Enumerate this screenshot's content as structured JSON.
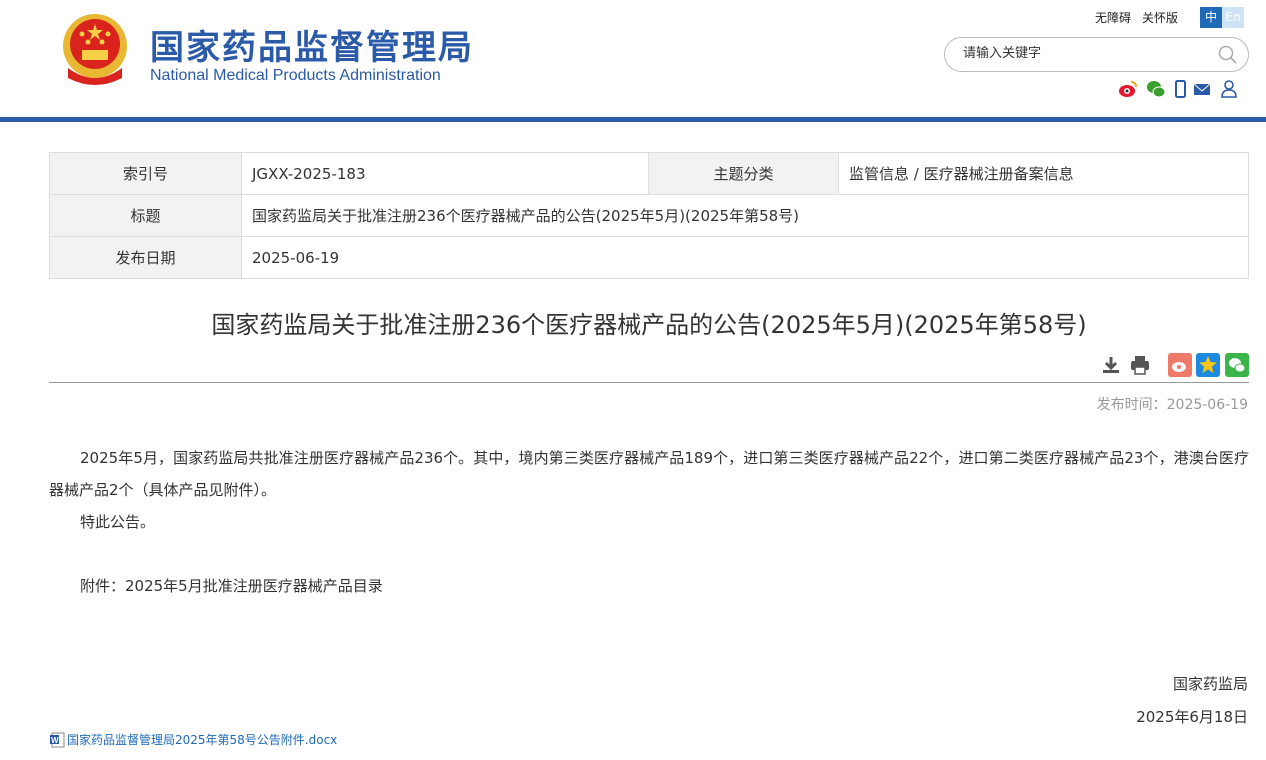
{
  "header": {
    "site_title": "国家药品监督管理局",
    "site_subtitle": "National Medical Products Administration",
    "accessibility": "无障碍",
    "care_mode": "关怀版",
    "lang_zh": "中",
    "lang_en": "En",
    "search_placeholder": "请输入关键字",
    "brand_color": "#2b5aa8"
  },
  "meta": {
    "index_label": "索引号",
    "index_value": "JGXX-2025-183",
    "category_label": "主题分类",
    "category_value": "监管信息 / 医疗器械注册备案信息",
    "title_label": "标题",
    "title_value": "国家药监局关于批准注册236个医疗器械产品的公告(2025年5月)(2025年第58号)",
    "date_label": "发布日期",
    "date_value": "2025-06-19"
  },
  "article": {
    "title": "国家药监局关于批准注册236个医疗器械产品的公告(2025年5月)(2025年第58号)",
    "publish_time": "发布时间：2025-06-19",
    "para1": "2025年5月，国家药监局共批准注册医疗器械产品236个。其中，境内第三类医疗器械产品189个，进口第三类医疗器械产品22个，进口第二类医疗器械产品23个，港澳台医疗器械产品2个（具体产品见附件）。",
    "para2": "特此公告。",
    "para3": "附件：2025年5月批准注册医疗器械产品目录",
    "sign_org": "国家药监局",
    "sign_date": "2025年6月18日",
    "attachment": "国家药品监督管理局2025年第58号公告附件.docx"
  }
}
